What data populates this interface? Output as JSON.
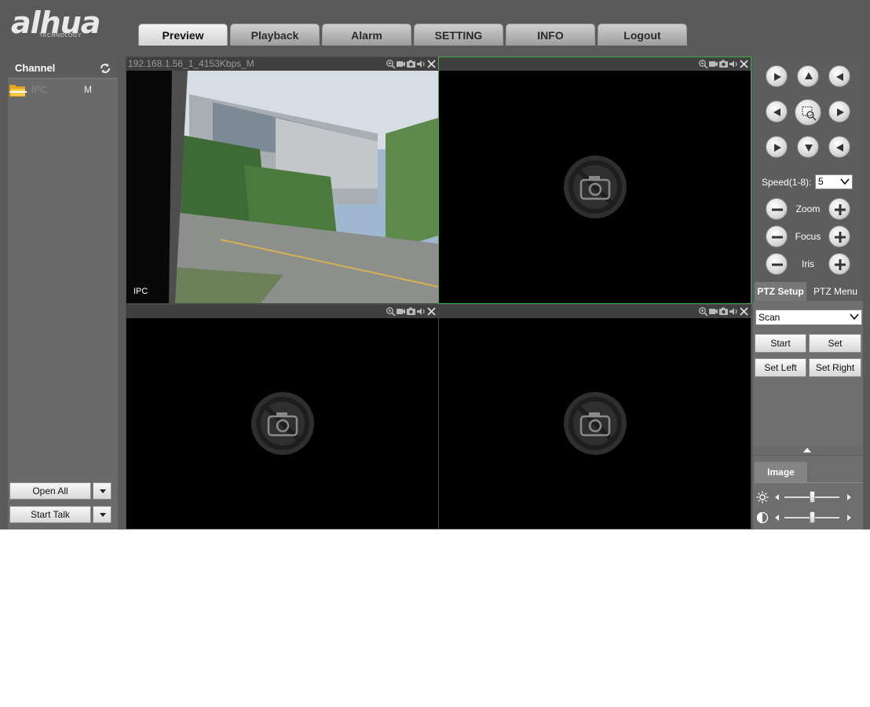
{
  "header": {
    "brand": "alhua",
    "brand_sub": "TECHNOLOGY",
    "nav": [
      {
        "label": "Preview",
        "active": true
      },
      {
        "label": "Playback",
        "active": false
      },
      {
        "label": "Alarm",
        "active": false
      },
      {
        "label": "SETTING",
        "active": false
      },
      {
        "label": "INFO",
        "active": false
      },
      {
        "label": "Logout",
        "active": false
      }
    ]
  },
  "channel_panel": {
    "title": "Channel",
    "refresh_icon": "refresh-icon",
    "channels": [
      {
        "name": "IPC",
        "stream": "M",
        "icon": "folder-icon"
      }
    ],
    "open_all_label": "Open All",
    "start_talk_label": "Start Talk"
  },
  "video": {
    "panes": [
      {
        "title": "192.168.1.56_1_4153Kbps_M",
        "overlay_label": "IPC",
        "has_video": true,
        "selected": false
      },
      {
        "title": "",
        "has_video": false,
        "selected": true
      },
      {
        "title": "",
        "has_video": false,
        "selected": false
      },
      {
        "title": "",
        "has_video": false,
        "selected": false
      }
    ],
    "pane_icons": [
      "zoom-icon",
      "record-icon",
      "snapshot-icon",
      "audio-icon",
      "close-icon"
    ],
    "empty_icon": "no-camera-icon"
  },
  "ptz": {
    "speed_label": "Speed(1-8):",
    "speed_value": "5",
    "zoom_label": "Zoom",
    "focus_label": "Focus",
    "iris_label": "Iris",
    "tabs": [
      {
        "label": "PTZ Setup",
        "active": true
      },
      {
        "label": "PTZ Menu",
        "active": false
      }
    ],
    "mode_value": "Scan",
    "buttons": {
      "start": "Start",
      "set": "Set",
      "set_left": "Set Left",
      "set_right": "Set Right"
    }
  },
  "image_panel": {
    "tab_label": "Image",
    "brightness_level": 0.5,
    "contrast_level": 0.5
  },
  "colors": {
    "background": "#5a5a5a",
    "selected_border": "#3fae3f",
    "video_bg": "#000000"
  }
}
